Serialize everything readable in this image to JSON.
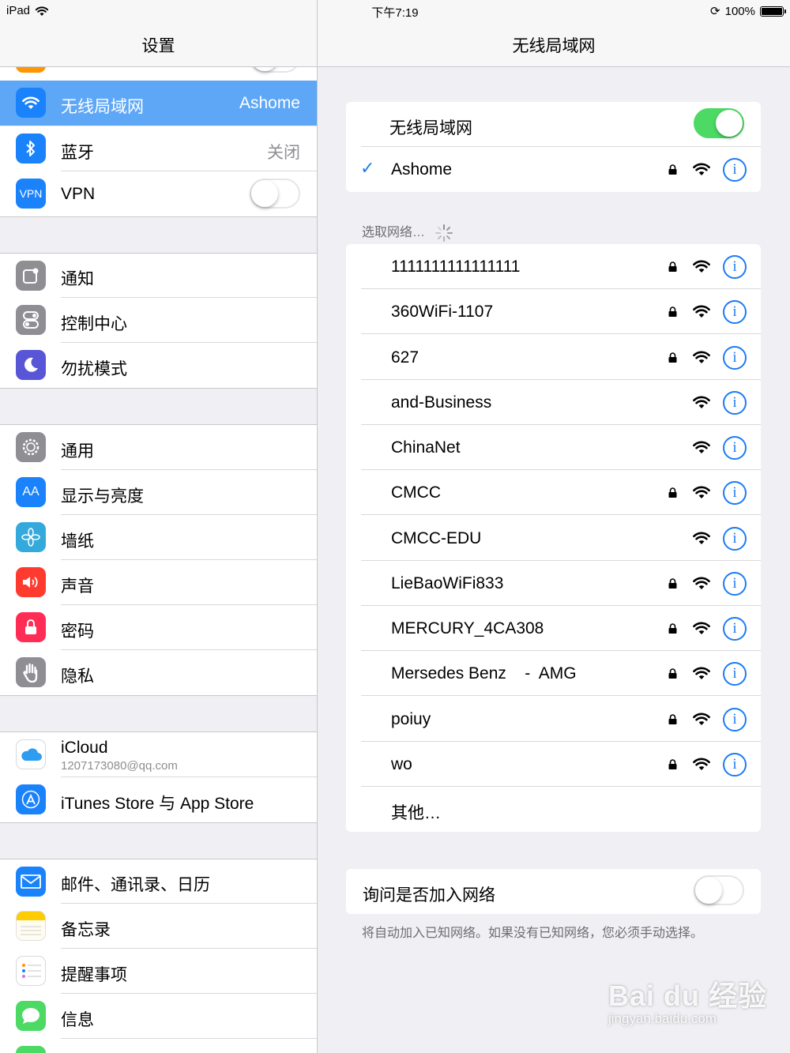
{
  "status_bar": {
    "device": "iPad",
    "time": "下午7:19",
    "battery": "100%",
    "battery_level": 1.0
  },
  "left_pane": {
    "title": "设置",
    "groups": [
      {
        "items": [
          {
            "label": "无线局域网",
            "value": "Ashome",
            "icon": "wifi-icon",
            "color": "#1a82fb",
            "selected": true
          },
          {
            "label": "蓝牙",
            "value": "关闭",
            "icon": "bluetooth-icon",
            "color": "#1a82fb"
          },
          {
            "label": "VPN",
            "icon": "vpn-icon",
            "icon_text": "VPN",
            "color": "#1a82fb",
            "toggle": false
          }
        ]
      },
      {
        "items": [
          {
            "label": "通知",
            "icon": "notifications-icon",
            "color": "#8e8e93"
          },
          {
            "label": "控制中心",
            "icon": "control-center-icon",
            "color": "#8e8e93"
          },
          {
            "label": "勿扰模式",
            "icon": "moon-icon",
            "color": "#5856d6"
          }
        ]
      },
      {
        "items": [
          {
            "label": "通用",
            "icon": "gear-icon",
            "color": "#8e8e93"
          },
          {
            "label": "显示与亮度",
            "icon": "display-icon",
            "icon_text": "AA",
            "color": "#1a82fb"
          },
          {
            "label": "墙纸",
            "icon": "wallpaper-icon",
            "color": "#34aadc"
          },
          {
            "label": "声音",
            "icon": "sound-icon",
            "color": "#ff3b30"
          },
          {
            "label": "密码",
            "icon": "passcode-icon",
            "color": "#ff2d55"
          },
          {
            "label": "隐私",
            "icon": "privacy-hand-icon",
            "color": "#8e8e93"
          }
        ]
      },
      {
        "items": [
          {
            "label": "iCloud",
            "sublabel": "1207173080@qq.com",
            "icon": "icloud-icon",
            "color": "#ffffff"
          },
          {
            "label": "iTunes Store 与 App Store",
            "icon": "app-store-icon",
            "color": "#1a82fb"
          }
        ]
      },
      {
        "items": [
          {
            "label": "邮件、通讯录、日历",
            "icon": "mail-icon",
            "color": "#1a82fb"
          },
          {
            "label": "备忘录",
            "icon": "notes-icon",
            "color": "#ffcc00"
          },
          {
            "label": "提醒事项",
            "icon": "reminders-icon",
            "color": "#ffffff"
          },
          {
            "label": "信息",
            "icon": "messages-icon",
            "color": "#4cd964"
          }
        ]
      }
    ]
  },
  "right_pane": {
    "title": "无线局域网",
    "wifi_toggle_label": "无线局域网",
    "wifi_on": true,
    "connected_network": "Ashome",
    "connected_locked": true,
    "choose_network_label": "选取网络…",
    "networks": [
      {
        "name": "1111111111111111",
        "locked": true
      },
      {
        "name": "360WiFi-1107",
        "locked": true
      },
      {
        "name": "627",
        "locked": true
      },
      {
        "name": "and-Business",
        "locked": false
      },
      {
        "name": "ChinaNet",
        "locked": false
      },
      {
        "name": "CMCC",
        "locked": true
      },
      {
        "name": "CMCC-EDU",
        "locked": false
      },
      {
        "name": "LieBaoWiFi833",
        "locked": true
      },
      {
        "name": "MERCURY_4CA308",
        "locked": true
      },
      {
        "name": "Mersedes Benz    -  AMG",
        "locked": true
      },
      {
        "name": "poiuy",
        "locked": true
      },
      {
        "name": "wo",
        "locked": true
      }
    ],
    "other_label": "其他…",
    "ask_join_label": "询问是否加入网络",
    "ask_join_on": false,
    "ask_join_note": "将自动加入已知网络。如果没有已知网络，您必须手动选择。"
  },
  "watermark": {
    "brand": "Bai du 经验",
    "url": "jingyan.baidu.com"
  },
  "colors": {
    "accent": "#1c7cf4",
    "selected_row": "#5ea7f7",
    "toggle_on": "#4cd964",
    "background": "#efeff4"
  }
}
